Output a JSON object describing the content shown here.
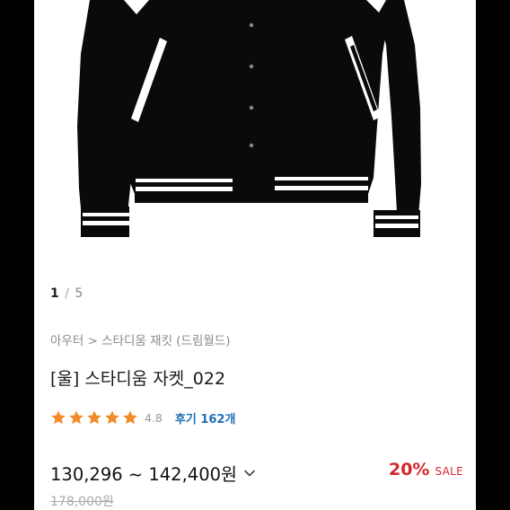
{
  "gallery": {
    "current": "1",
    "separator": "/",
    "total": "5"
  },
  "breadcrumb": {
    "category": "아우터",
    "arrow": ">",
    "subcategory": "스타디움 재킷 (드림월드)"
  },
  "product": {
    "title": "[울] 스타디움 자켓_022",
    "rating": "4.8",
    "review_label": "후기 162개",
    "stars": 5,
    "price_range": "130,296 ~ 142,400원",
    "discount_percent": "20%",
    "discount_label": "SALE",
    "original_price": "178,000원"
  },
  "icons": {
    "chevron": "chevron-down-icon",
    "star": "star-icon"
  },
  "colors": {
    "star": "#f28b2a",
    "discount": "#d6262e",
    "review_link": "#1f6fb5",
    "jacket_body": "#0a0a0a",
    "jacket_stripe": "#ffffff"
  }
}
